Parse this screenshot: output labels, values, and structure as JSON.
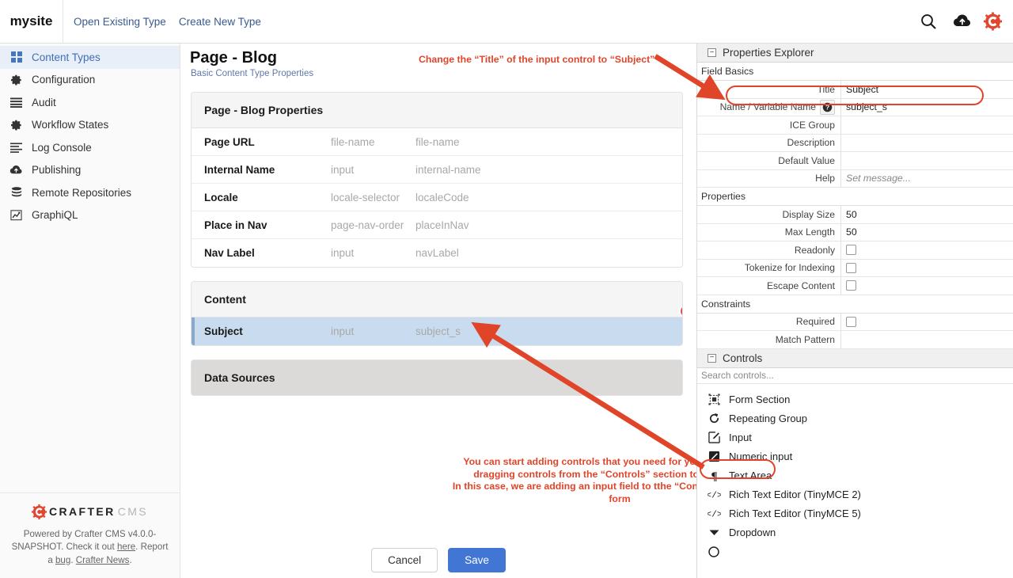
{
  "topbar": {
    "brand": "mysite",
    "links": [
      {
        "label": "Open Existing Type"
      },
      {
        "label": "Create New Type"
      }
    ],
    "icons": [
      {
        "name": "search-icon"
      },
      {
        "name": "publish-cloud-icon"
      },
      {
        "name": "crafter-logo-icon"
      }
    ]
  },
  "sidebar": {
    "items": [
      {
        "label": "Content Types",
        "icon": "grid-icon",
        "active": true
      },
      {
        "label": "Configuration",
        "icon": "gear-icon",
        "active": false
      },
      {
        "label": "Audit",
        "icon": "list-icon",
        "active": false
      },
      {
        "label": "Workflow States",
        "icon": "gear-icon",
        "active": false
      },
      {
        "label": "Log Console",
        "icon": "lines-icon",
        "active": false
      },
      {
        "label": "Publishing",
        "icon": "cloud-icon",
        "active": false
      },
      {
        "label": "Remote Repositories",
        "icon": "database-icon",
        "active": false
      },
      {
        "label": "GraphiQL",
        "icon": "chart-line-icon",
        "active": false
      }
    ],
    "footer": {
      "logo_primary": "CRAFTER",
      "logo_secondary": "CMS",
      "text_part1": "Powered by Crafter CMS v4.0.0-SNAPSHOT. Check it out ",
      "link_here": "here",
      "text_part2": ". Report a ",
      "link_bug": "bug",
      "text_part3": ". ",
      "link_news": "Crafter News",
      "text_part4": "."
    }
  },
  "main": {
    "title": "Page - Blog",
    "subtitle": "Basic Content Type Properties",
    "sections": [
      {
        "header": "Page - Blog Properties",
        "style": "light",
        "rows": [
          {
            "label": "Page URL",
            "control": "file-name",
            "variable": "file-name",
            "selected": false
          },
          {
            "label": "Internal Name",
            "control": "input",
            "variable": "internal-name",
            "selected": false
          },
          {
            "label": "Locale",
            "control": "locale-selector",
            "variable": "localeCode",
            "selected": false
          },
          {
            "label": "Place in Nav",
            "control": "page-nav-order",
            "variable": "placeInNav",
            "selected": false
          },
          {
            "label": "Nav Label",
            "control": "input",
            "variable": "navLabel",
            "selected": false
          }
        ]
      },
      {
        "header": "Content",
        "style": "light",
        "rows": [
          {
            "label": "Subject",
            "control": "input",
            "variable": "subject_s",
            "selected": true,
            "delete_badge": "✕"
          }
        ]
      },
      {
        "header": "Data Sources",
        "style": "gray",
        "rows": []
      }
    ],
    "annotations": [
      {
        "id": "top",
        "text": "Change the “Title” of the input control to “Subject”"
      },
      {
        "id": "mid",
        "text": "You can start adding controls that you need for your page layout by\ndragging controls from the “Controls” section to the form area.\nIn this case, we are adding an input field to tthe “Content” section of the form"
      }
    ],
    "buttons": {
      "cancel": "Cancel",
      "save": "Save"
    }
  },
  "properties_explorer": {
    "title": "Properties Explorer",
    "collapse_glyph": "−",
    "groups": [
      {
        "name": "Field Basics",
        "rows": [
          {
            "label": "Title",
            "value": "Subject",
            "type": "text",
            "highlighted": true
          },
          {
            "label": "Name / Variable Name",
            "value": "subject_s",
            "type": "text",
            "help": true
          },
          {
            "label": "ICE Group",
            "value": "",
            "type": "text"
          },
          {
            "label": "Description",
            "value": "",
            "type": "text"
          },
          {
            "label": "Default Value",
            "value": "",
            "type": "text"
          },
          {
            "label": "Help",
            "value": "Set message...",
            "type": "placeholder"
          }
        ]
      },
      {
        "name": "Properties",
        "rows": [
          {
            "label": "Display Size",
            "value": "50",
            "type": "text"
          },
          {
            "label": "Max Length",
            "value": "50",
            "type": "text"
          },
          {
            "label": "Readonly",
            "value": "",
            "type": "checkbox",
            "checked": false
          },
          {
            "label": "Tokenize for Indexing",
            "value": "",
            "type": "checkbox",
            "checked": false
          },
          {
            "label": "Escape Content",
            "value": "",
            "type": "checkbox",
            "checked": false
          }
        ]
      },
      {
        "name": "Constraints",
        "rows": [
          {
            "label": "Required",
            "value": "",
            "type": "checkbox",
            "checked": false
          },
          {
            "label": "Match Pattern",
            "value": "",
            "type": "text"
          }
        ]
      }
    ]
  },
  "controls": {
    "title": "Controls",
    "collapse_glyph": "−",
    "search_placeholder": "Search controls...",
    "items": [
      {
        "label": "Form Section",
        "icon": "form-section-icon",
        "highlighted": false
      },
      {
        "label": "Repeating Group",
        "icon": "repeat-icon",
        "highlighted": false
      },
      {
        "label": "Input",
        "icon": "pencil-box-icon",
        "highlighted": true
      },
      {
        "label": "Numeric input",
        "icon": "numeric-input-icon",
        "highlighted": false
      },
      {
        "label": "Text Area",
        "icon": "pilcrow-icon",
        "highlighted": false
      },
      {
        "label": "Rich Text Editor (TinyMCE 2)",
        "icon": "code-icon",
        "highlighted": false
      },
      {
        "label": "Rich Text Editor (TinyMCE 5)",
        "icon": "code-icon",
        "highlighted": false
      },
      {
        "label": "Dropdown",
        "icon": "chevron-down-icon",
        "highlighted": false
      }
    ]
  },
  "colors": {
    "accent_red": "#e0452a",
    "brand_blue": "#4276d4",
    "selected_row": "#c9dcef",
    "gray_section": "#dcdad8"
  }
}
